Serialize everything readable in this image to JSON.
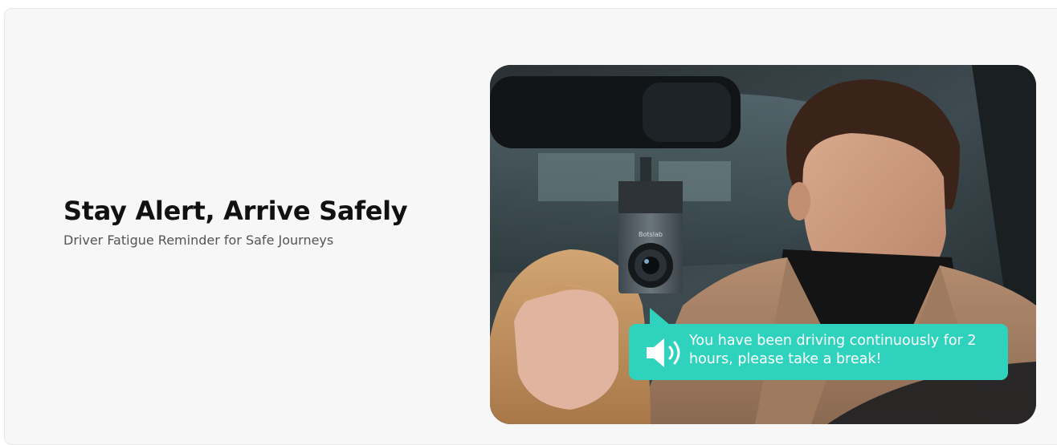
{
  "feature": {
    "title": "Stay Alert, Arrive Safely",
    "subtitle": "Driver Fatigue Reminder for Safe Journeys"
  },
  "photo": {
    "camera_brand": "Botslab",
    "alert_message": "You have been driving continuously for 2 hours, please take a break!",
    "alert_icon": "speaker-sound-icon"
  },
  "colors": {
    "background": "#f7f7f7",
    "bubble": "#2fd3bd",
    "headline": "#111111",
    "subheadline": "#555555"
  }
}
